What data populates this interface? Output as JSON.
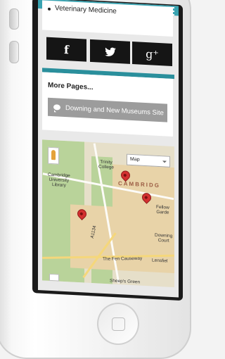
{
  "page": {
    "list_item": "Veterinary Medicine",
    "more_pages_heading": "More Pages...",
    "site_link_label": "Downing and New Museums Site"
  },
  "social": {
    "facebook_glyph": "f",
    "twitter_glyph": "🐦",
    "googleplus_glyph": "g⁺"
  },
  "map": {
    "map_type": "Map",
    "labels": {
      "cambridge_university_library": "Cambridge\nUniversity\nLibrary",
      "trinity_college": "Trinity\nCollege",
      "city": "CAMBRIDG",
      "fellows_garden": "Fellow\nGarde",
      "downing_court": "Downing\nCourt",
      "a1134": "A1134",
      "the_fen_causeway": "The Fen Causeway",
      "lensfield": "Lensfiel",
      "sheeps_green": "Sheep's Green"
    },
    "marker_count": 3
  },
  "colors": {
    "header": "#39a3b1",
    "divider": "#2a8f9c",
    "social_bg": "#151515",
    "site_button": "#9c9c9c",
    "marker": "#d33030"
  }
}
